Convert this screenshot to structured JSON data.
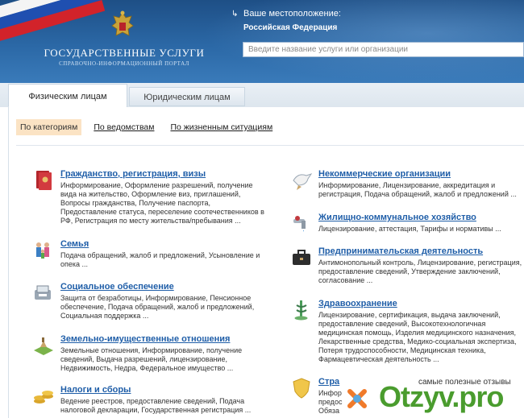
{
  "header": {
    "title": "ГОСУДАРСТВЕННЫЕ УСЛУГИ",
    "subtitle": "СПРАВОЧНО-ИНФОРМАЦИОННЫЙ ПОРТАЛ",
    "location_label": "Ваше местоположение:",
    "location_value": "Российская Федерация",
    "search_placeholder": "Введите название услуги или организации"
  },
  "tabs": [
    {
      "label": "Физическим лицам",
      "active": true
    },
    {
      "label": "Юридическим лицам",
      "active": false
    }
  ],
  "subnav": [
    {
      "label": "По категориям",
      "active": true
    },
    {
      "label": "По ведомствам",
      "active": false
    },
    {
      "label": "По жизненным ситуациям",
      "active": false
    }
  ],
  "categories_left": [
    {
      "title": "Гражданство, регистрация, визы",
      "icon": "passport-icon",
      "lines": [
        "Информирование, Оформление разрешений, получение",
        "вида на жительство, Оформление виз, приглашений,",
        "Вопросы гражданства, Получение паспорта,",
        "Предоставление статуса, переселение соотечественников в",
        "РФ, Регистрация по месту жительства/пребывания ..."
      ]
    },
    {
      "title": "Семья",
      "icon": "family-icon",
      "lines": [
        "Подача обращений, жалоб и предложений, Усыновление и",
        "опека ..."
      ]
    },
    {
      "title": "Социальное обеспечение",
      "icon": "social-security-icon",
      "lines": [
        "Защита от безработицы, Информирование, Пенсионное",
        "обеспечение, Подача обращений, жалоб и предложений,",
        "Социальная поддержка ..."
      ]
    },
    {
      "title": "Земельно-имущественные отношения",
      "icon": "land-icon",
      "lines": [
        "Земельные отношения, Информирование, получение",
        "сведений, Выдача разрешений, лицензирование,",
        "Недвижимость, Недра, Федеральное имущество ..."
      ]
    },
    {
      "title": "Налоги и сборы",
      "icon": "coins-icon",
      "lines": [
        "Ведение реестров, предоставление сведений, Подача",
        "налоговой декларации, Государственная регистрация ..."
      ]
    }
  ],
  "categories_right": [
    {
      "title": "Некоммерческие организации",
      "icon": "dove-icon",
      "lines": [
        "Информирование, Лицензирование, аккредитация и",
        "регистрация, Подача обращений, жалоб и предложений ..."
      ]
    },
    {
      "title": "Жилищно-коммунальное хозяйство",
      "icon": "faucet-icon",
      "lines": [
        "Лицензирование, аттестация, Тарифы и нормативы ..."
      ]
    },
    {
      "title": "Предпринимательская деятельность",
      "icon": "briefcase-icon",
      "lines": [
        "Антимонопольный контроль, Лицензирование, регистрация,",
        "предоставление сведений, Утверждение заключений,",
        "согласование ..."
      ]
    },
    {
      "title": "Здравоохранение",
      "icon": "medicine-icon",
      "lines": [
        "Лицензирование, сертификация, выдача заключений,",
        "предоставление сведений, Высокотехнологичная",
        "медицинская помощь, Изделия медицинского назначения,",
        "Лекарственные средства, Медико-социальная экспертиза,",
        "Потеря трудоспособности, Медицинская техника,",
        "Фармацевтическая деятельность ..."
      ]
    },
    {
      "title": "Стра",
      "icon": "shield-icon",
      "lines": [
        "Инфор",
        "предос",
        "Обяза"
      ]
    }
  ],
  "watermark": {
    "caption": "самые полезные отзывы",
    "brand": "Otzyv.pro"
  }
}
